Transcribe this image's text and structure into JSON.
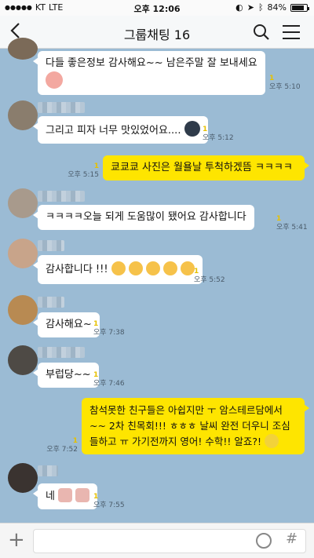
{
  "status": {
    "carrier": "KT",
    "network": "LTE",
    "time": "오후 12:06",
    "battery": "84%",
    "battery_level": 0.84
  },
  "header": {
    "title": "그룹채팅 16"
  },
  "messages": [
    {
      "text": "다들 좋은정보 감사해요~~ 남은주말 잘 보내세요",
      "unread": "1",
      "time": "오후 5:10"
    },
    {
      "text": "그리고 피자 너무 맛있었어요....",
      "unread": "1",
      "time": "오후 5:12"
    },
    {
      "text": "쿄쿄쿄 사진은 월욜날 투척하겠뜸 ㅋㅋㅋㅋ",
      "unread": "1",
      "time": "오후 5:15"
    },
    {
      "text": "ㅋㅋㅋㅋ오늘 되게 도움많이 됐어요 감사합니다",
      "unread": "1",
      "time": "오후 5:41"
    },
    {
      "text": "감사합니다 !!!",
      "unread": "1",
      "time": "오후 5:52"
    },
    {
      "text": "감사해요~",
      "unread": "1",
      "time": "오후 7:38"
    },
    {
      "text": "부럽당~~",
      "unread": "1",
      "time": "오후 7:46"
    },
    {
      "text": "참석못한 친구들은 아쉽지만 ㅜ 암스테르담에서 ~~ 2차 친목회!!! ㅎㅎㅎ 날씨 완전 더우니 조심들하고 ㅠ 가기전까지 영어! 수학!! 알죠?!",
      "unread": "1",
      "time": "오후 7:52"
    },
    {
      "text": "네",
      "unread": "1",
      "time": "오후 7:55"
    }
  ],
  "colors": {
    "background": "#9bbbd4",
    "my_bubble": "#fee500",
    "other_bubble": "#ffffff",
    "unread": "#e6c100"
  },
  "icons": [
    "back-chevron-icon",
    "search-icon",
    "menu-icon",
    "plus-icon",
    "emoticon-icon",
    "hash-icon"
  ]
}
